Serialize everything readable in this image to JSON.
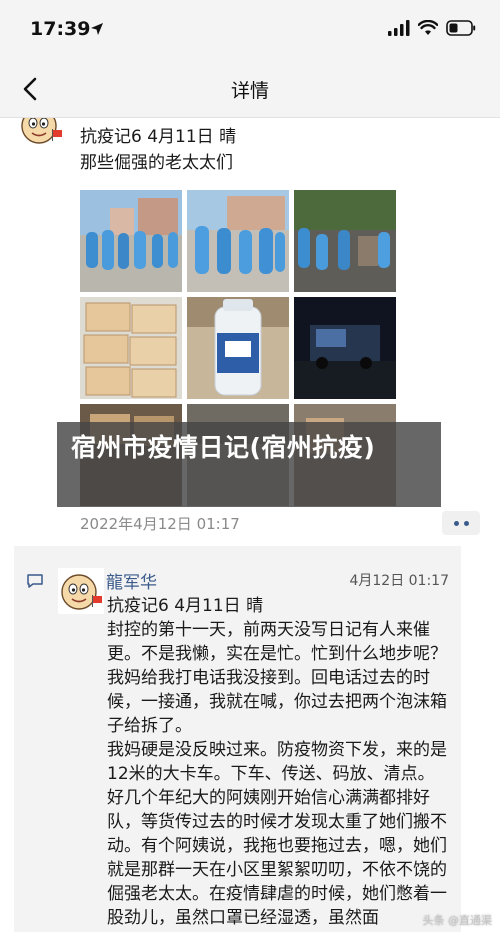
{
  "status_bar": {
    "time": "17:39",
    "icons": [
      "location-arrow-icon",
      "cellular-signal-icon",
      "wifi-icon",
      "battery-icon"
    ]
  },
  "nav": {
    "title": "详情",
    "back_icon": "chevron-left-icon"
  },
  "post": {
    "line1": "抗疫记6  4月11日  晴",
    "line2": "那些倔强的老太太们",
    "photos": [
      "photo-workers-ppe-1",
      "photo-workers-ppe-2",
      "photo-workers-ppe-3",
      "photo-supply-boxes",
      "photo-disinfectant-bottle",
      "photo-night-truck",
      "photo-boxes-stack-2",
      "photo-street-scene",
      "photo-boxes-doorway"
    ],
    "overlay_title": "宿州市疫情日记(宿州抗疫)",
    "date": "2022年4月12日 01:17"
  },
  "comment": {
    "name": "龍军华",
    "time": "4月12日 01:17",
    "body": [
      "抗疫记6   4月11日   晴",
      "封控的第十一天，前两天没写日记有人来催更。不是我懒，实在是忙。忙到什么地步呢？我妈给我打电话我没接到。回电话过去的时候，一接通，我就在喊，你过去把两个泡沫箱子给拆了。",
      "我妈硬是没反映过来。防疫物资下发，来的是12米的大卡车。下车、传送、码放、清点。好几个年纪大的阿姨刚开始信心满满都排好队，等货传过去的时候才发现太重了她们搬不动。有个阿姨说，我拖也要拖过去，嗯，她们就是那群一天在小区里絮絮叨叨，不依不饶的倔强老太太。在疫情肆虐的时候，她们憋着一股劲儿，虽然口罩已经湿透，虽然面"
    ]
  },
  "watermark": "头条 @直通渠",
  "colors": {
    "link": "#3b5b8c",
    "meta": "#8a8a8a",
    "card_bg": "#f3f3f3",
    "bar_bg": "#f4f4f4"
  }
}
